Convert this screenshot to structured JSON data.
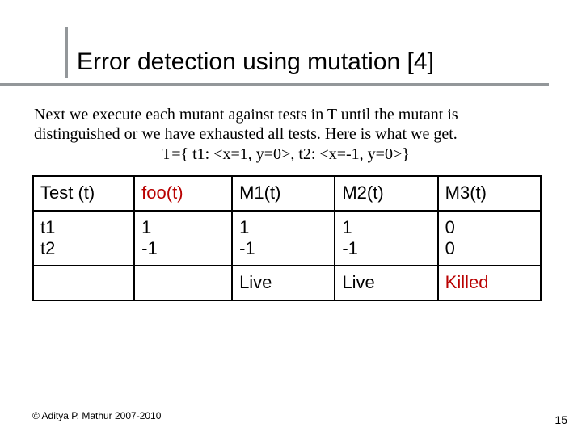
{
  "title": "Error detection using mutation [4]",
  "paragraph": "Next we execute each mutant against tests in T until the mutant is distinguished or we have exhausted all tests. Here is what we get.",
  "t_line": "T={ t1: <x=1, y=0>, t2: <x=-1, y=0>}",
  "table": {
    "header": [
      "Test (t)",
      "foo(t)",
      "M1(t)",
      "M2(t)",
      "M3(t)"
    ],
    "row_tests": "t1\nt2",
    "row_vals": [
      "1\n-1",
      "1\n-1",
      "1\n-1",
      "0\n0"
    ],
    "status": [
      "Live",
      "Live",
      "Killed"
    ]
  },
  "copyright": "© Aditya P. Mathur 2007-2010",
  "page_number": "15"
}
